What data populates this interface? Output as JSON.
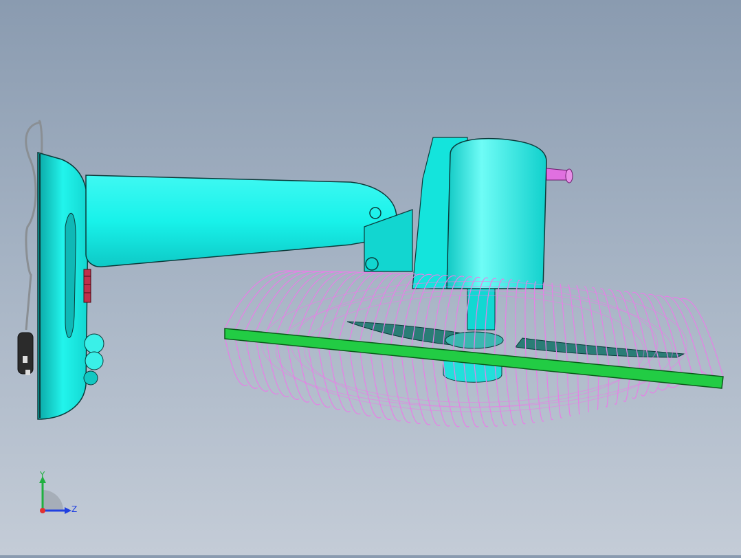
{
  "scene": {
    "model": "wall-mounted-fan",
    "colors": {
      "body": "#18f2ea",
      "body_shade": "#0fb8b6",
      "edge": "#0b3a3a",
      "guard_wire": "#e680e6",
      "guard_ring": "#22cc44",
      "blade": "#2a7d76",
      "knob": "#e060e0"
    }
  },
  "triad": {
    "y_label": "Y",
    "z_label": "Z",
    "x_color": "#e23030",
    "y_color": "#20b040",
    "z_color": "#2040e0"
  }
}
